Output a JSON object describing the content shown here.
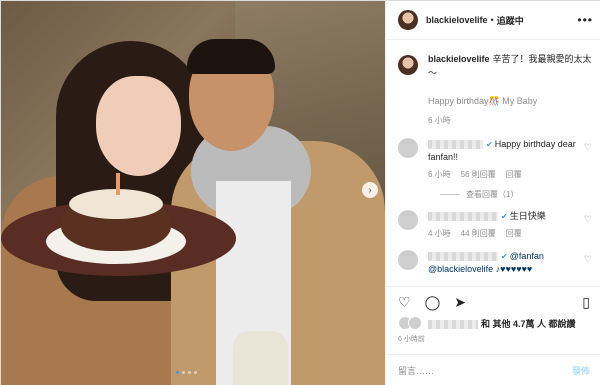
{
  "post": {
    "username": "blackielovelife",
    "separator": "•",
    "follow_status": "追蹤中",
    "more_icon": "more-horizontal-icon"
  },
  "caption": {
    "username": "blackielovelife",
    "text": "辛苦了！我最親愛的太太～",
    "wish": "Happy birthday🎊 My Baby",
    "timestamp": "6 小時"
  },
  "comments": [
    {
      "text": "Happy birthday dear fanfan!!",
      "time": "6 小時",
      "likes": "56 則回覆",
      "reply": "回覆",
      "view_replies": "查看回覆（1）"
    },
    {
      "text": "生日快樂",
      "time": "4 小時",
      "likes": "44 則回覆",
      "reply": "回覆"
    },
    {
      "mention_name": "@fanfan",
      "text": "@blackielovelife ♪♥♥♥♥♥♥"
    }
  ],
  "likes": {
    "text": "和 其他 4.7萬 人 都說讚"
  },
  "post_time": "6 小時前",
  "add_comment": {
    "placeholder": "留言……",
    "post_label": "發佈"
  },
  "colors": {
    "accent": "#3897f0",
    "muted_text": "#8e8e8e",
    "border": "#efefef"
  }
}
